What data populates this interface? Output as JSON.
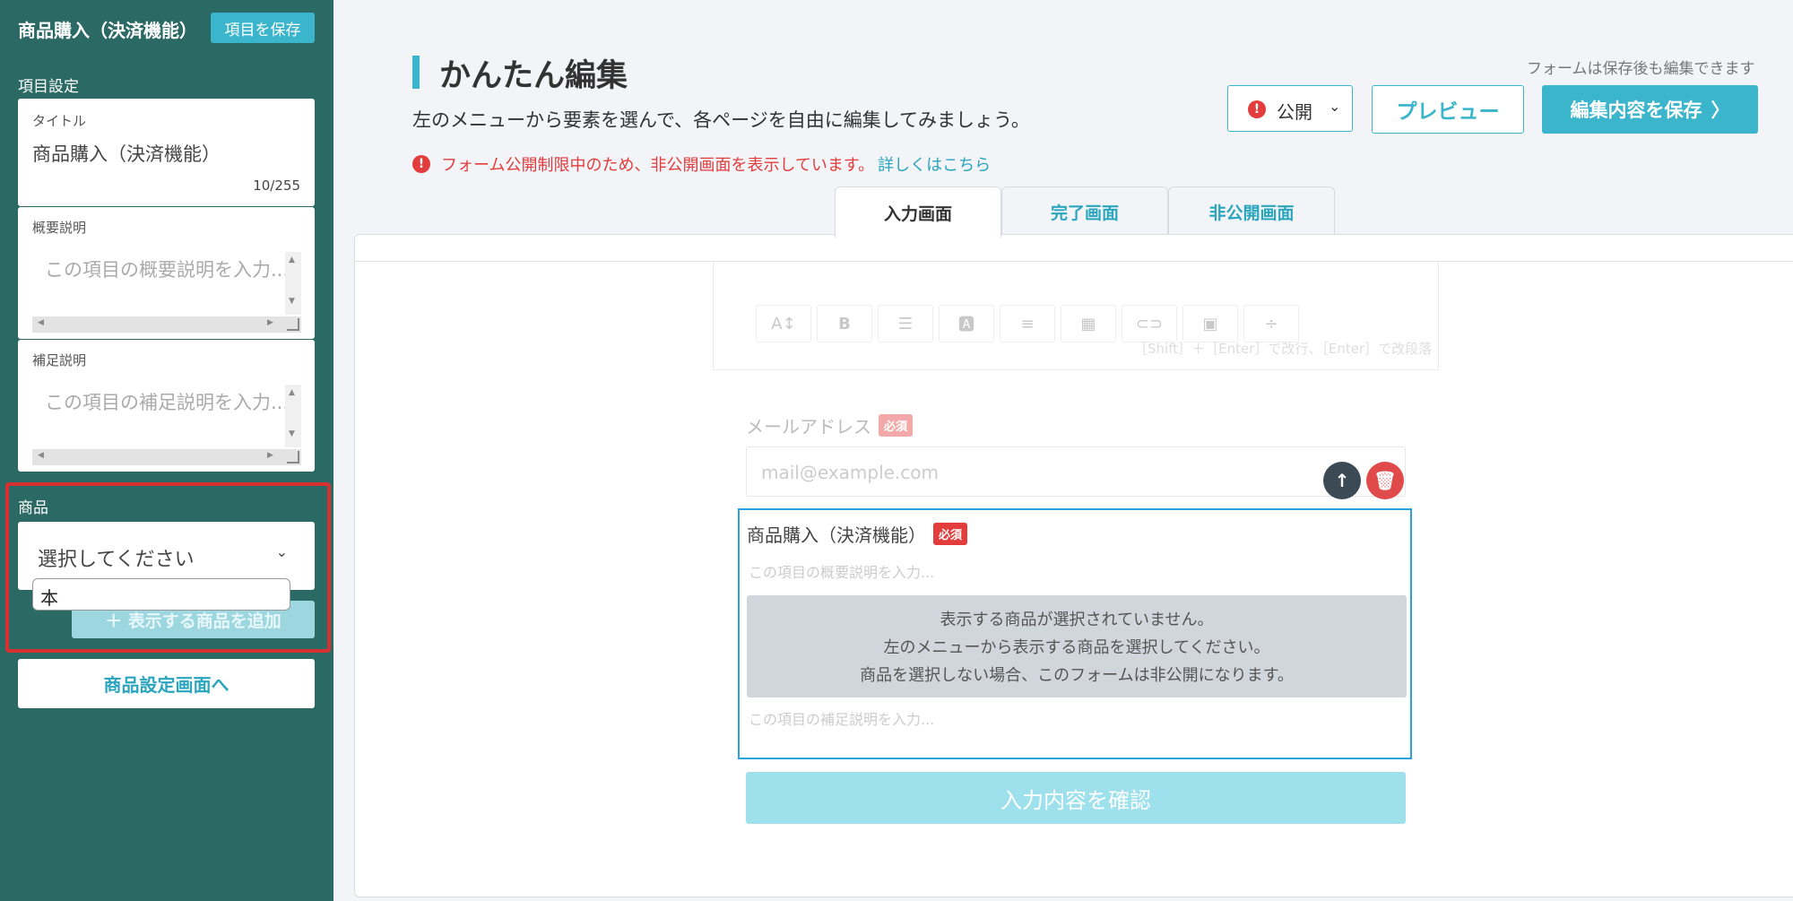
{
  "sidebar": {
    "title": "商品購入（決済機能）",
    "save_label": "項目を保存",
    "section_label": "項目設定",
    "title_card": {
      "label": "タイトル",
      "value": "商品購入（決済機能）",
      "counter": "10/255"
    },
    "summary_card": {
      "label": "概要説明",
      "placeholder": "この項目の概要説明を入力..."
    },
    "supplement_card": {
      "label": "補足説明",
      "placeholder": "この項目の補足説明を入力..."
    },
    "product": {
      "label": "商品",
      "select_placeholder": "選択してください",
      "dropdown_option": "本",
      "add_label": "＋ 表示する商品を追加"
    },
    "goto_label": "商品設定画面へ"
  },
  "header": {
    "title": "かんたん編集",
    "subtitle": "左のメニューから要素を選んで、各ページを自由に編集してみましょう。",
    "warning_text": "フォーム公開制限中のため、非公開画面を表示しています。",
    "warning_link": "詳しくはこちら",
    "save_note": "フォームは保存後も編集できます",
    "publish_label": "公開",
    "preview_label": "プレビュー",
    "save_label": "編集内容を保存"
  },
  "tabs": [
    {
      "label": "入力画面",
      "active": true
    },
    {
      "label": "完了画面",
      "active": false
    },
    {
      "label": "非公開画面",
      "active": false
    }
  ],
  "editor": {
    "toolbar_icons": [
      "font-size-icon",
      "bold-icon",
      "list-icon",
      "text-color-icon",
      "align-icon",
      "table-icon",
      "link-icon",
      "image-icon",
      "divider-icon"
    ],
    "toolbar_hint": "［Shift］＋［Enter］で改行、［Enter］で改段落"
  },
  "form": {
    "email_label": "メールアドレス",
    "required_badge": "必須",
    "email_placeholder": "mail@example.com",
    "field_title": "商品購入（決済機能）",
    "summary_placeholder": "この項目の概要説明を入力...",
    "notice_line1": "表示する商品が選択されていません。",
    "notice_line2": "左のメニューから表示する商品を選択してください。",
    "notice_line3": "商品を選択しない場合、このフォームは非公開になります。",
    "supplement_placeholder": "この項目の補足説明を入力...",
    "confirm_label": "入力内容を確認"
  },
  "colors": {
    "sidebar": "#2b6a64",
    "accent": "#3bb5cc",
    "danger": "#e23c3c",
    "selected_border": "#2aa0dc"
  }
}
